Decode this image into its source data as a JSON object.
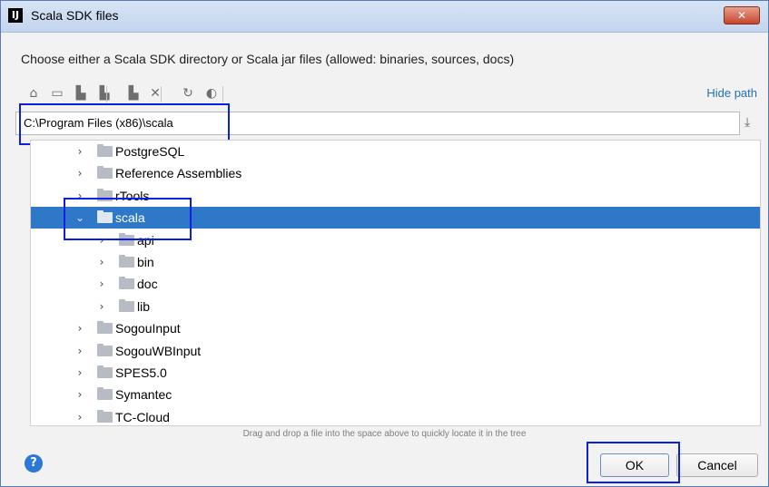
{
  "window": {
    "title": "Scala SDK files",
    "app_icon": "intellij-icon",
    "close_label": "✕"
  },
  "description": "Choose either a Scala SDK directory or Scala jar files (allowed: binaries, sources, docs)",
  "toolbar": {
    "buttons": [
      {
        "name": "home-icon",
        "glyph": "⌂"
      },
      {
        "name": "desktop-icon",
        "glyph": "▭"
      },
      {
        "name": "project-folder-icon",
        "glyph": "▙"
      },
      {
        "name": "module-folder-icon",
        "glyph": "▙"
      },
      {
        "name": "new-folder-icon",
        "glyph": "▙"
      },
      {
        "name": "delete-icon",
        "glyph": "✕"
      },
      {
        "name": "refresh-icon",
        "glyph": "↻"
      },
      {
        "name": "show-hidden-icon",
        "glyph": "◐"
      }
    ],
    "hide_path_label": "Hide path"
  },
  "path": {
    "value": "C:\\Program Files (x86)\\scala"
  },
  "tree": {
    "items": [
      {
        "label": "PostgreSQL",
        "depth": 0,
        "expanded": false,
        "selected": false
      },
      {
        "label": "Reference Assemblies",
        "depth": 0,
        "expanded": false,
        "selected": false
      },
      {
        "label": "rTools",
        "depth": 0,
        "expanded": false,
        "selected": false
      },
      {
        "label": "scala",
        "depth": 0,
        "expanded": true,
        "selected": true
      },
      {
        "label": "api",
        "depth": 1,
        "expanded": false,
        "selected": false
      },
      {
        "label": "bin",
        "depth": 1,
        "expanded": false,
        "selected": false
      },
      {
        "label": "doc",
        "depth": 1,
        "expanded": false,
        "selected": false
      },
      {
        "label": "lib",
        "depth": 1,
        "expanded": false,
        "selected": false
      },
      {
        "label": "SogouInput",
        "depth": 0,
        "expanded": false,
        "selected": false
      },
      {
        "label": "SogouWBInput",
        "depth": 0,
        "expanded": false,
        "selected": false
      },
      {
        "label": "SPES5.0",
        "depth": 0,
        "expanded": false,
        "selected": false
      },
      {
        "label": "Symantec",
        "depth": 0,
        "expanded": false,
        "selected": false
      },
      {
        "label": "TC-Cloud",
        "depth": 0,
        "expanded": false,
        "selected": false
      }
    ]
  },
  "hint": "Drag and drop a file into the space above to quickly locate it in the tree",
  "help_label": "?",
  "buttons": {
    "ok": "OK",
    "cancel": "Cancel"
  },
  "colors": {
    "selection": "#2f78c8",
    "link": "#2470b3",
    "annotation_box": "#0a1fe6"
  }
}
